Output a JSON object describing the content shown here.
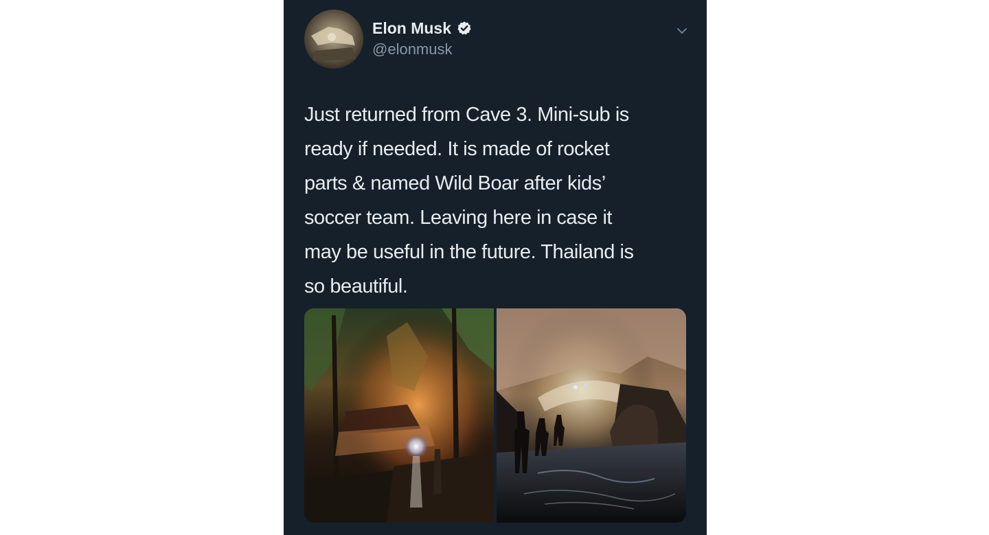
{
  "tweet": {
    "author": {
      "display_name": "Elon Musk",
      "handle": "@elonmusk",
      "verified_icon": "verified-badge-icon",
      "avatar_icon": "avatar-image"
    },
    "menu_icon": "chevron-down-icon",
    "text_lines": [
      "Just returned from Cave 3. Mini-sub is",
      "ready if needed. It is made of rocket",
      "parts & named Wild Boar after kids’",
      "soccer team. Leaving here in case it",
      "may be useful in the future. Thailand is",
      "so beautiful."
    ],
    "media": [
      {
        "name": "jungle-night-photo"
      },
      {
        "name": "cave-entrance-photo"
      }
    ]
  },
  "colors": {
    "card_background": "#15202b",
    "primary_text": "#e8ecef",
    "secondary_text": "#8899a6",
    "page_background": "#ffffff"
  }
}
